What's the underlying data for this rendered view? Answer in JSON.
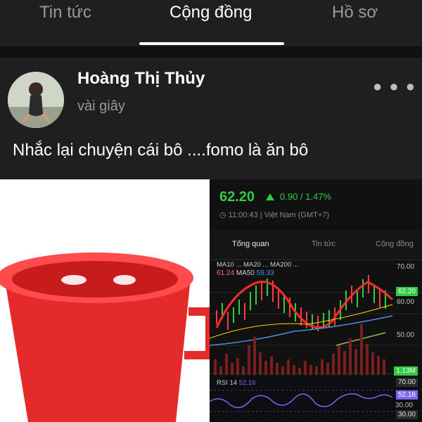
{
  "tabs": [
    {
      "label": "Tin tức"
    },
    {
      "label": "Cộng đồng"
    },
    {
      "label": "Hồ sơ"
    }
  ],
  "post": {
    "author": "Hoàng Thị Thủy",
    "time": "vài giây",
    "text": "Nhắc lại chuyện cái bô ....fomo là ăn bô",
    "more_icon": "more-horizontal-icon"
  },
  "stock_panel": {
    "price": "62.20",
    "change": "0.90 / 1.47%",
    "timestamp": "11:00:43 | Việt Nam (GMT+7)",
    "tabs": [
      "Tổng quan",
      "Tin tức",
      "Cộng đồng"
    ],
    "ma_line1": "MA10 ... MA20 ... MA200 ...",
    "ma_value1": "61.24",
    "ma_label2": "MA50",
    "ma_value2": "59.33",
    "y_ticks": [
      "70.00",
      "62.20",
      "60.00",
      "50.00"
    ],
    "volume_label": "1.13M",
    "rsi_label": "RSI 14",
    "rsi_value": "52.16",
    "rsi_ticks": [
      "70.00",
      "52.16",
      "30.00",
      "30.00"
    ],
    "colors": {
      "up": "#2ecc40",
      "down": "#ff3b3b",
      "accent": "#4a90e2"
    }
  }
}
